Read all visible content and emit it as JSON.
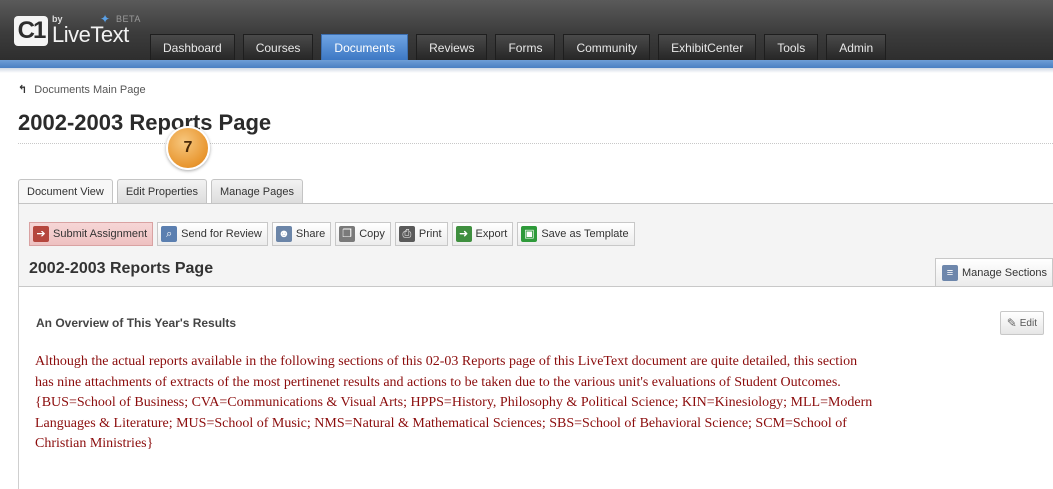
{
  "app": {
    "logo_by": "by",
    "logo_name": "LiveText",
    "logo_badge": "BETA",
    "logo_c1": "C1"
  },
  "nav": {
    "tabs": [
      {
        "label": "Dashboard"
      },
      {
        "label": "Courses"
      },
      {
        "label": "Documents",
        "active": true
      },
      {
        "label": "Reviews"
      },
      {
        "label": "Forms"
      },
      {
        "label": "Community"
      },
      {
        "label": "ExhibitCenter"
      },
      {
        "label": "Tools"
      },
      {
        "label": "Admin"
      }
    ]
  },
  "breadcrumb": {
    "label": "Documents Main Page",
    "icon": "back-arrow-icon"
  },
  "page": {
    "title": "2002-2003 Reports Page",
    "step_badge": "7"
  },
  "subtabs": [
    {
      "label": "Document View",
      "active": true
    },
    {
      "label": "Edit Properties"
    },
    {
      "label": "Manage Pages"
    }
  ],
  "toolbar": {
    "submit": "Submit Assignment",
    "send_review": "Send for Review",
    "share": "Share",
    "copy": "Copy",
    "print": "Print",
    "export": "Export",
    "save_template": "Save as Template"
  },
  "section": {
    "title": "2002-2003 Reports Page",
    "manage_sections": "Manage Sections",
    "heading": "An Overview of This Year's Results",
    "edit": "Edit",
    "body_lines": [
      "Although the actual reports available in the following sections of this 02-03 Reports page of this LiveText document are quite detailed, this section",
      "has nine attachments of extracts of the most pertinenet results and actions to be taken due to the various unit's evaluations of Student Outcomes.",
      "{BUS=School of Business; CVA=Communications & Visual Arts; HPPS=History, Philosophy & Political Science; KIN=Kinesiology; MLL=Modern",
      "Languages & Literature; MUS=School of Music; NMS=Natural & Mathematical Sciences; SBS=School of Behavioral Science; SCM=School of",
      "Christian Ministries}"
    ]
  },
  "colors": {
    "accent_blue": "#4a7fc2",
    "body_text": "#8b0c0c",
    "badge_orange": "#e8962f"
  }
}
